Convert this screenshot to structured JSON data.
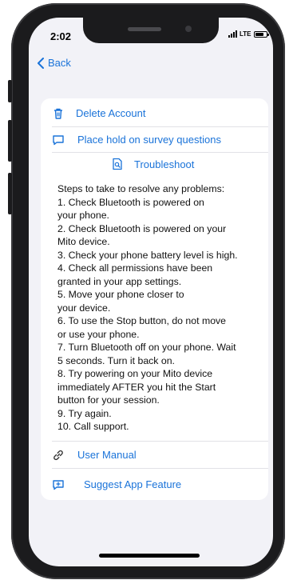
{
  "status_bar": {
    "time": "2:02",
    "network": "LTE"
  },
  "nav": {
    "back_label": "Back"
  },
  "menu": {
    "delete_account": "Delete Account",
    "place_hold": "Place hold on survey questions",
    "troubleshoot": "Troubleshoot",
    "user_manual": "User Manual",
    "suggest_feature": "Suggest App Feature"
  },
  "troubleshoot_steps": {
    "lines": [
      "Steps to take to resolve any problems:",
      "1. Check Bluetooth is powered on",
      "your phone.",
      "2. Check Bluetooth is powered on your",
      "Mito device.",
      "3. Check your phone battery level is high.",
      "4. Check all permissions have been",
      "granted in your app settings.",
      "5. Move your phone closer to",
      "your device.",
      "6. To use the Stop button, do not move",
      "or use your phone.",
      "7. Turn Bluetooth off on your phone. Wait",
      "5 seconds.  Turn it back on.",
      "8. Try powering on your Mito device",
      "immediately AFTER you hit the Start",
      "button for your session.",
      "9. Try again.",
      "10. Call support."
    ]
  },
  "icons": {
    "delete": "trash-icon",
    "hold": "message-icon",
    "troubleshoot": "document-search-icon",
    "manual": "link-icon",
    "suggest": "message-plus-icon",
    "back": "chevron-left-icon"
  },
  "colors": {
    "accent": "#1a73d9",
    "background": "#f2f2f7",
    "card": "#ffffff"
  }
}
